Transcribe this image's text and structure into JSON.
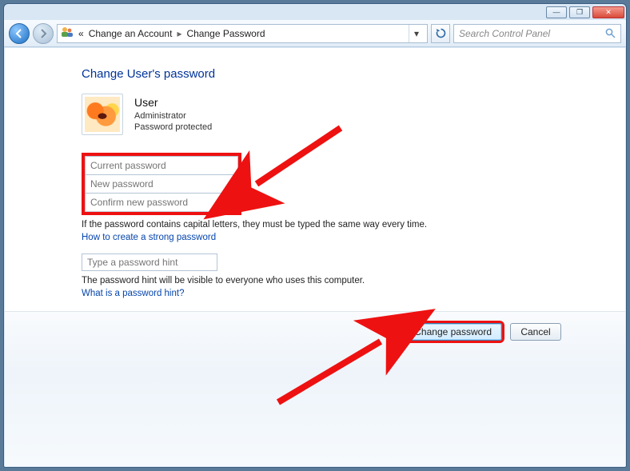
{
  "window_controls": {
    "minimize": "—",
    "maximize": "❐",
    "close": "✕"
  },
  "nav": {
    "breadcrumb1": "Change an Account",
    "breadcrumb2": "Change Password"
  },
  "search": {
    "placeholder": "Search Control Panel"
  },
  "page": {
    "title": "Change User's password",
    "user": {
      "name": "User",
      "role": "Administrator",
      "protection": "Password protected"
    },
    "fields": {
      "current_placeholder": "Current password",
      "new_placeholder": "New password",
      "confirm_placeholder": "Confirm new password",
      "hint_placeholder": "Type a password hint"
    },
    "note_caps": "If the password contains capital letters, they must be typed the same way every time.",
    "link_strong": "How to create a strong password",
    "note_hint": "The password hint will be visible to everyone who uses this computer.",
    "link_hint": "What is a password hint?"
  },
  "buttons": {
    "change": "Change password",
    "cancel": "Cancel"
  }
}
